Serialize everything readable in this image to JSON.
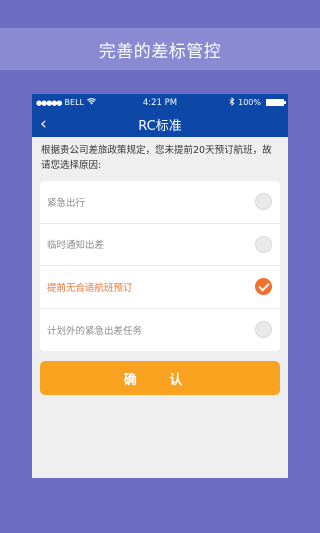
{
  "banner": {
    "title": "完善的差标管控"
  },
  "status_bar": {
    "carrier": "BELL",
    "time": "4:21 PM",
    "battery": "100%"
  },
  "nav": {
    "title": "RC标准"
  },
  "notice": "根据贵公司差旅政策规定，您未提前20天预订航班，故请您选择原因:",
  "options": [
    {
      "label": "紧急出行",
      "selected": false
    },
    {
      "label": "临时通知出差",
      "selected": false
    },
    {
      "label": "提前无合适航班预订",
      "selected": true
    },
    {
      "label": "计划外的紧急出差任务",
      "selected": false
    }
  ],
  "confirm_label": "确 认",
  "colors": {
    "background": "#6c6dc2",
    "nav": "#0d48a8",
    "accent": "#f07030",
    "button": "#f9a21f"
  }
}
